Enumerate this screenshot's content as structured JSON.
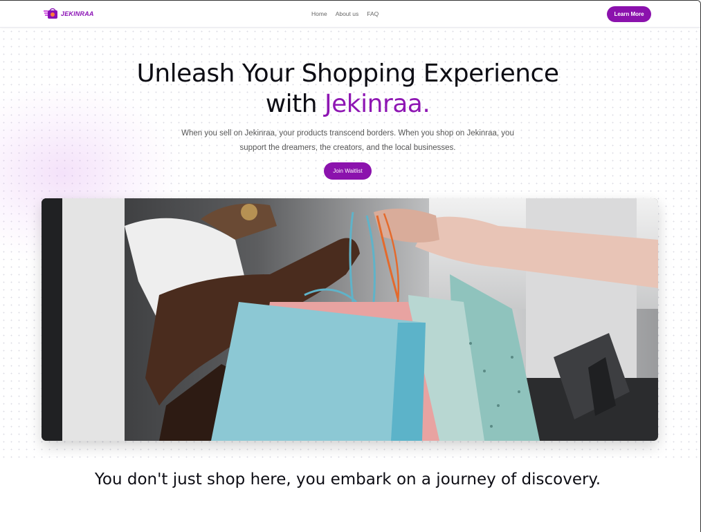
{
  "nav": {
    "logo_text": "JEKINRAA",
    "links": [
      "Home",
      "About us",
      "FAQ"
    ],
    "cta_label": "Learn More"
  },
  "hero": {
    "title_line1": "Unleash Your Shopping Experience",
    "title_line2_prefix": "with ",
    "title_accent": "Jekinraa.",
    "subtitle": "When you sell on Jekinraa, your products transcend borders. When you shop on Jekinraa, you support the dreamers, the creators, and the local businesses.",
    "cta_label": "Join Waitlist"
  },
  "tagline": "You don't just shop here, you embark on a journey of discovery.",
  "colors": {
    "brand_purple": "#8b12ad",
    "text_dark": "#0d0d14",
    "text_muted": "#555555"
  },
  "icons": {
    "logo": "shopping-bag-logo-icon"
  }
}
